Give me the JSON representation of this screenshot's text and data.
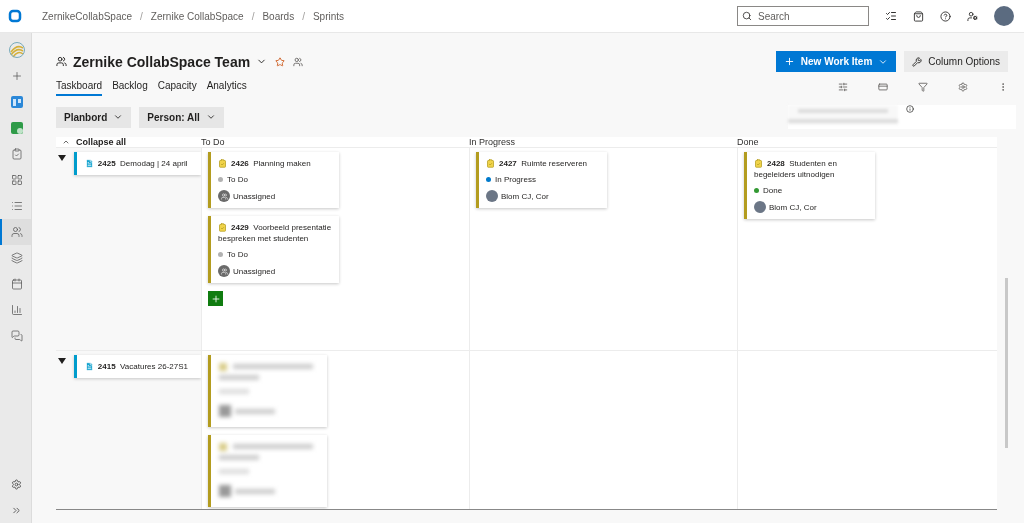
{
  "breadcrumb": [
    {
      "label": "ZernikeCollabSpace"
    },
    {
      "separator": "/",
      "label": "Zernike CollabSpace"
    },
    {
      "separator": "/",
      "label": "Boards"
    },
    {
      "separator": "/",
      "label": "Sprints"
    }
  ],
  "search": {
    "placeholder": "Search"
  },
  "rail": [
    {
      "selected": false
    },
    {
      "selected": false
    },
    {
      "selected": false
    },
    {
      "selected": false
    },
    {
      "selected": false
    },
    {
      "selected": false
    },
    {
      "selected": false
    },
    {
      "selected": true
    },
    {
      "selected": false
    },
    {
      "selected": false
    },
    {
      "selected": false
    },
    {
      "selected": false
    }
  ],
  "team": {
    "name": "Zernike CollabSpace Team",
    "favorite": false
  },
  "tabs": [
    {
      "label": "Taskboard",
      "selected": true
    },
    {
      "label": "Backlog",
      "selected": false
    },
    {
      "label": "Capacity",
      "selected": false
    },
    {
      "label": "Analytics",
      "selected": false
    }
  ],
  "actions": {
    "new_work_item": "New Work Item",
    "column_options": "Column Options"
  },
  "filters": [
    "Planbord",
    "Person: All"
  ],
  "board": {
    "collapse_label": "Collapse all",
    "columns": [
      "To Do",
      "In Progress",
      "Done"
    ],
    "rows": [
      {
        "expanded": true,
        "show_add": true,
        "parent": {
          "id": "2425",
          "title": "Demodag | 24 april"
        },
        "cells": [
          [
            {
              "kind": "task",
              "id": "2426",
              "title": "Planning maken",
              "state": "To Do",
              "color": "#b2b2b2",
              "assignee": "Unassigned",
              "assigned": false
            },
            {
              "kind": "task",
              "id": "2429",
              "title": "Voorbeeld presentatie bespreken met studenten",
              "state": "To Do",
              "color": "#b2b2b2",
              "assignee": "Unassigned",
              "assigned": false
            }
          ],
          [
            {
              "kind": "task",
              "id": "2427",
              "title": "Ruimte reserveren",
              "state": "In Progress",
              "color": "#007acc",
              "assignee": "Blom CJ, Cor",
              "assigned": true
            }
          ],
          [
            {
              "kind": "task",
              "id": "2428",
              "title": "Studenten en begeleiders uitnodigen",
              "state": "Done",
              "color": "#339933",
              "assignee": "Blom CJ, Cor",
              "assigned": true
            }
          ]
        ]
      },
      {
        "expanded": true,
        "show_add": false,
        "parent": {
          "id": "2415",
          "title": "Vacatures 26-27S1"
        },
        "cells": [
          [
            {
              "kind": "obscured"
            },
            {
              "kind": "obscured"
            }
          ],
          [],
          []
        ]
      }
    ]
  }
}
